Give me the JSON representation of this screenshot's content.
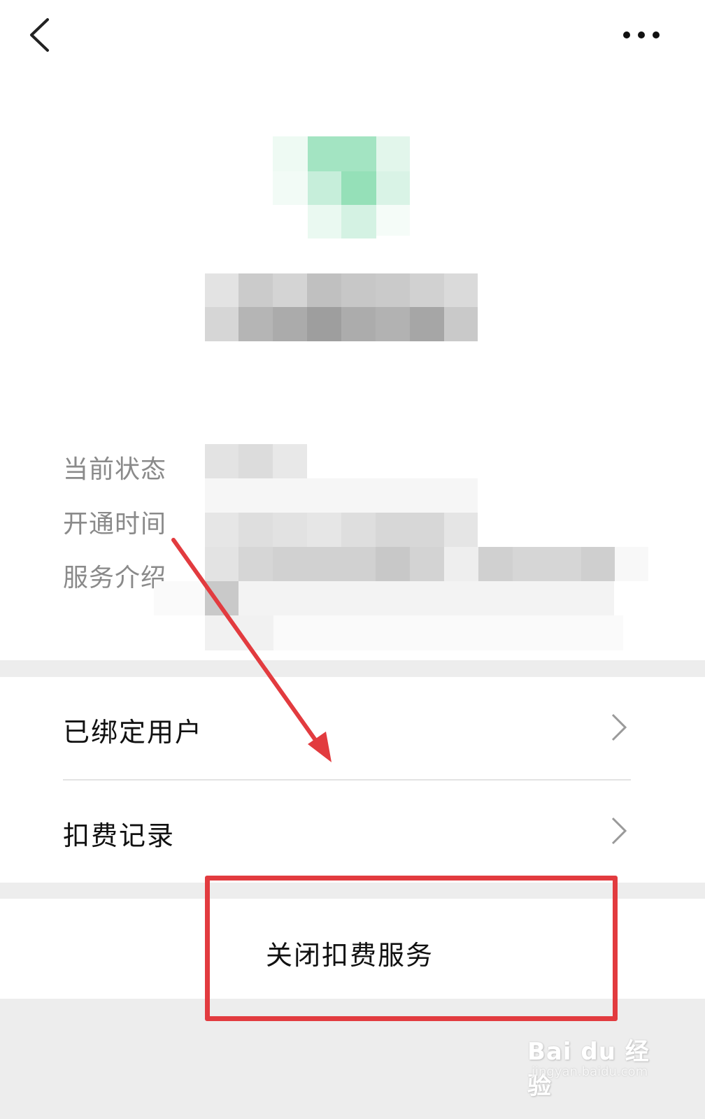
{
  "info_labels": {
    "status": "当前状态",
    "open_time": "开通时间",
    "service_intro": "服务介绍"
  },
  "menu": {
    "bound_users": "已绑定用户",
    "deduction_records": "扣费记录"
  },
  "actions": {
    "close_service": "关闭扣费服务"
  },
  "watermark": {
    "brand": "Bai du 经验",
    "url": "jingyan.baidu.com"
  },
  "icons": {
    "back": "back-arrow-icon",
    "more": "more-dots-icon",
    "chevron": "chevron-right-icon"
  },
  "colors": {
    "annotation_red": "#e23b3f",
    "band_gray": "#ededed",
    "label_gray": "#8a8a8a"
  }
}
